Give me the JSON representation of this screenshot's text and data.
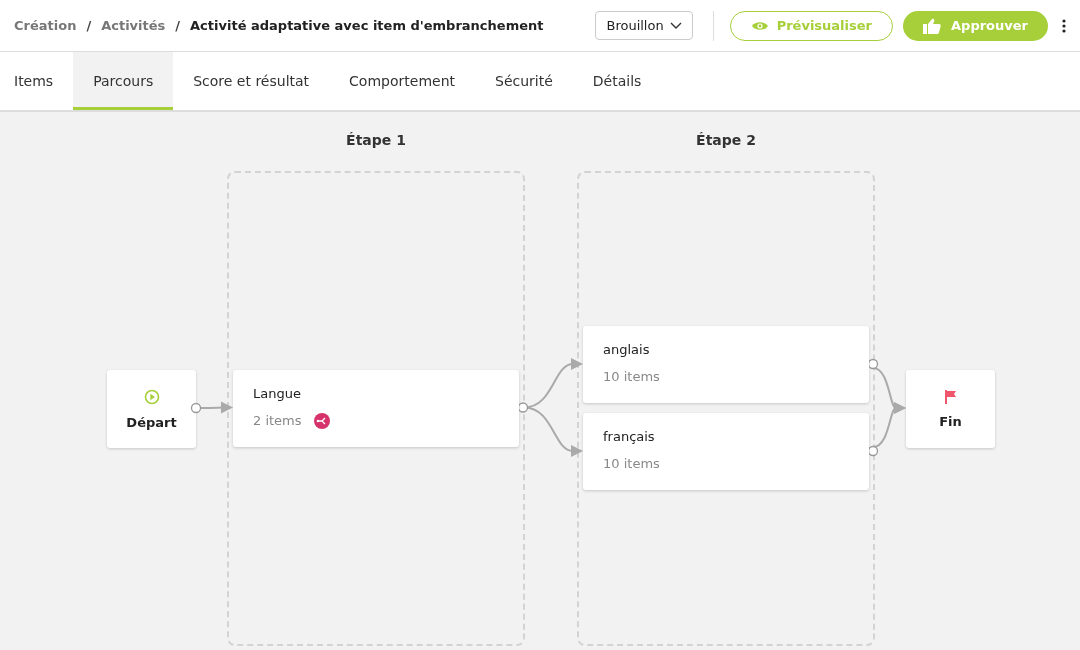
{
  "breadcrumb": [
    {
      "label": "Création",
      "current": false
    },
    {
      "label": "Activités",
      "current": false
    },
    {
      "label": "Activité adaptative avec item d'embranchement",
      "current": true
    }
  ],
  "breadcrumb_separator": "/",
  "status_dropdown": {
    "value": "Brouillon"
  },
  "actions": {
    "preview": "Prévisualiser",
    "approve": "Approuver"
  },
  "tabs": [
    {
      "label": "Items",
      "selected": false
    },
    {
      "label": "Parcours",
      "selected": true
    },
    {
      "label": "Score et résultat",
      "selected": false
    },
    {
      "label": "Comportement",
      "selected": false
    },
    {
      "label": "Sécurité",
      "selected": false
    },
    {
      "label": "Détails",
      "selected": false
    }
  ],
  "flow": {
    "start": {
      "label": "Départ"
    },
    "end": {
      "label": "Fin"
    },
    "stages": [
      {
        "title": "Étape 1",
        "nodes": [
          {
            "name": "Langue",
            "count": "2 items",
            "branching": true
          }
        ]
      },
      {
        "title": "Étape 2",
        "nodes": [
          {
            "name": "anglais",
            "count": "10 items",
            "branching": false
          },
          {
            "name": "français",
            "count": "10 items",
            "branching": false
          }
        ]
      }
    ]
  }
}
